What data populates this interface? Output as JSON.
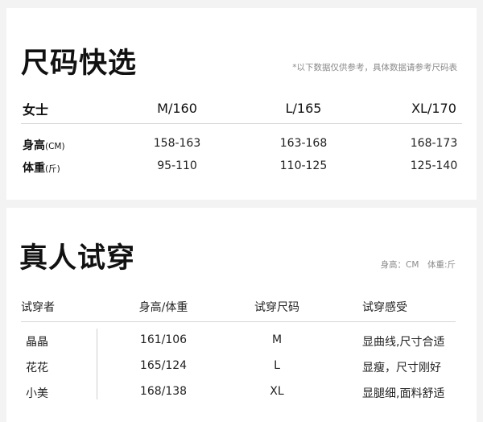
{
  "size_guide": {
    "title": "尺码快选",
    "note": "*以下数据仅供参考，具体数据请参考尺码表",
    "header": {
      "label": "女士",
      "sizes": [
        "M/160",
        "L/165",
        "XL/170"
      ]
    },
    "rows": [
      {
        "label": "身高",
        "unit": "(CM)",
        "values": [
          "158-163",
          "163-168",
          "168-173"
        ]
      },
      {
        "label": "体重",
        "unit": "(斤)",
        "values": [
          "95-110",
          "110-125",
          "125-140"
        ]
      }
    ]
  },
  "try_on": {
    "title": "真人试穿",
    "note": "身高：CM　体重:斤",
    "headers": [
      "试穿者",
      "身高/体重",
      "试穿尺码",
      "试穿感受"
    ],
    "rows": [
      {
        "name": "晶晶",
        "hw": "161/106",
        "size": "M",
        "feel": "显曲线,尺寸合适"
      },
      {
        "name": "花花",
        "hw": "165/124",
        "size": "L",
        "feel": "显瘦，尺寸刚好"
      },
      {
        "name": "小美",
        "hw": "168/138",
        "size": "XL",
        "feel": "显腿细,面料舒适"
      }
    ]
  }
}
